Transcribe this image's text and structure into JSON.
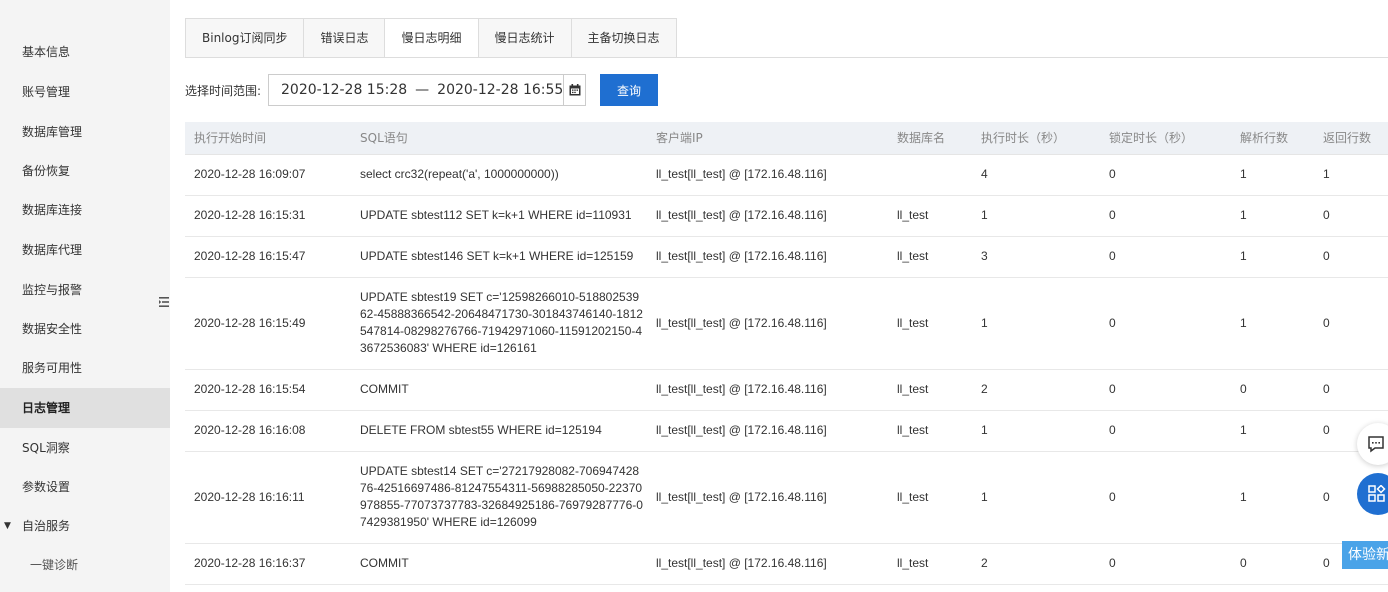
{
  "sidebar": {
    "items": [
      {
        "label": "基本信息"
      },
      {
        "label": "账号管理"
      },
      {
        "label": "数据库管理"
      },
      {
        "label": "备份恢复"
      },
      {
        "label": "数据库连接"
      },
      {
        "label": "数据库代理"
      },
      {
        "label": "监控与报警"
      },
      {
        "label": "数据安全性"
      },
      {
        "label": "服务可用性"
      },
      {
        "label": "日志管理"
      },
      {
        "label": "SQL洞察"
      },
      {
        "label": "参数设置"
      },
      {
        "label": "自治服务"
      },
      {
        "label": "一键诊断"
      }
    ],
    "active": "日志管理"
  },
  "tabs": [
    {
      "label": "Binlog订阅同步"
    },
    {
      "label": "错误日志"
    },
    {
      "label": "慢日志明细"
    },
    {
      "label": "慢日志统计"
    },
    {
      "label": "主备切换日志"
    }
  ],
  "active_tab": "慢日志明细",
  "filter": {
    "label": "选择时间范围:",
    "start": "2020-12-28 15:28",
    "separator": "—",
    "end": "2020-12-28 16:55",
    "query_label": "查询"
  },
  "table": {
    "columns": [
      "执行开始时间",
      "SQL语句",
      "客户端IP",
      "数据库名",
      "执行时长（秒）",
      "锁定时长（秒）",
      "解析行数",
      "返回行数"
    ],
    "rows": [
      [
        "2020-12-28 16:09:07",
        "select crc32(repeat('a', 1000000000))",
        "ll_test[ll_test] @ [172.16.48.116]",
        "",
        "4",
        "0",
        "1",
        "1"
      ],
      [
        "2020-12-28 16:15:31",
        "UPDATE sbtest112 SET k=k+1 WHERE id=110931",
        "ll_test[ll_test] @ [172.16.48.116]",
        "ll_test",
        "1",
        "0",
        "1",
        "0"
      ],
      [
        "2020-12-28 16:15:47",
        "UPDATE sbtest146 SET k=k+1 WHERE id=125159",
        "ll_test[ll_test] @ [172.16.48.116]",
        "ll_test",
        "3",
        "0",
        "1",
        "0"
      ],
      [
        "2020-12-28 16:15:49",
        "UPDATE sbtest19 SET c='12598266010-51880253962-45888366542-20648471730-301843746140-1812547814-08298276766-71942971060-11591202150-43672536083' WHERE id=126161",
        "ll_test[ll_test] @ [172.16.48.116]",
        "ll_test",
        "1",
        "0",
        "1",
        "0"
      ],
      [
        "2020-12-28 16:15:54",
        "COMMIT",
        "ll_test[ll_test] @ [172.16.48.116]",
        "ll_test",
        "2",
        "0",
        "0",
        "0"
      ],
      [
        "2020-12-28 16:16:08",
        "DELETE FROM sbtest55 WHERE id=125194",
        "ll_test[ll_test] @ [172.16.48.116]",
        "ll_test",
        "1",
        "0",
        "1",
        "0"
      ],
      [
        "2020-12-28 16:16:11",
        "UPDATE sbtest14 SET c='27217928082-70694742876-42516697486-81247554311-56988285050-22370978855-77073737783-32684925186-76979287776-07429381950' WHERE id=126099",
        "ll_test[ll_test] @ [172.16.48.116]",
        "ll_test",
        "1",
        "0",
        "1",
        "0"
      ],
      [
        "2020-12-28 16:16:37",
        "COMMIT",
        "ll_test[ll_test] @ [172.16.48.116]",
        "ll_test",
        "2",
        "0",
        "0",
        "0"
      ]
    ]
  },
  "floating": {
    "try_label": "体验新"
  },
  "colors": {
    "primary": "#1f6fd1",
    "sidebar_bg": "#f4f4f4",
    "sidebar_active": "#e0e0e0",
    "header_bg": "#eef1f5",
    "try_bg": "#4aa3e8"
  }
}
